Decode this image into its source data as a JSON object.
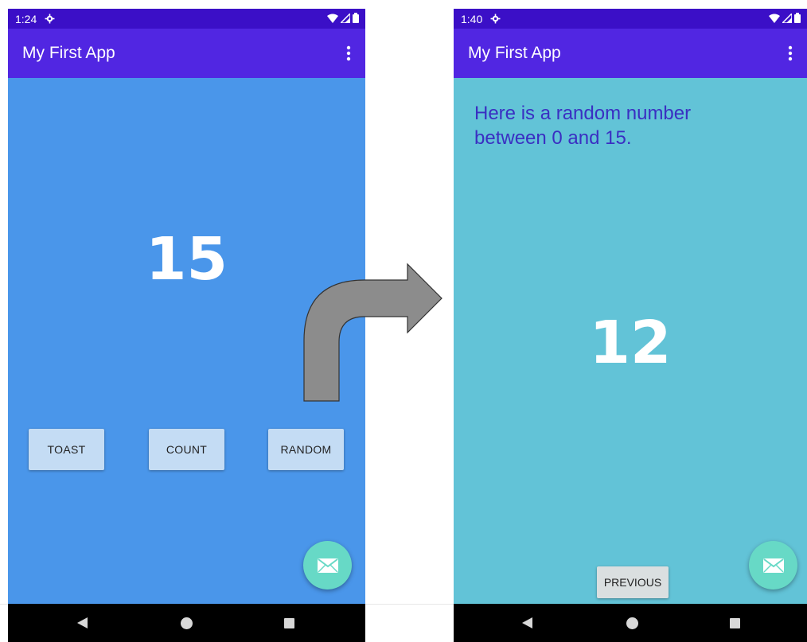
{
  "screens": [
    {
      "status_time": "1:24",
      "app_title": "My First App",
      "number": "15",
      "buttons": {
        "toast": "TOAST",
        "count": "COUNT",
        "random": "RANDOM"
      }
    },
    {
      "status_time": "1:40",
      "app_title": "My First App",
      "label": "Here is a random number between 0 and 15.",
      "number": "12",
      "previous": "PREVIOUS"
    }
  ],
  "icons": {
    "status": [
      "gear-icon",
      "wifi-icon",
      "signal-icon",
      "battery-icon"
    ],
    "appbar": "overflow-menu-icon",
    "fab": "email-icon",
    "nav": [
      "back-icon",
      "home-icon",
      "recents-icon"
    ],
    "transition": "curved-arrow-icon"
  },
  "colors": {
    "status_bar": "#3b0fc7",
    "app_bar": "#5126e2",
    "first_background": "#4a96ea",
    "second_background": "#62c3d7",
    "button": "#c4dcf4",
    "fab": "#67d9c6",
    "label_text": "#3a2fc2",
    "arrow": "#8c8c8c"
  }
}
